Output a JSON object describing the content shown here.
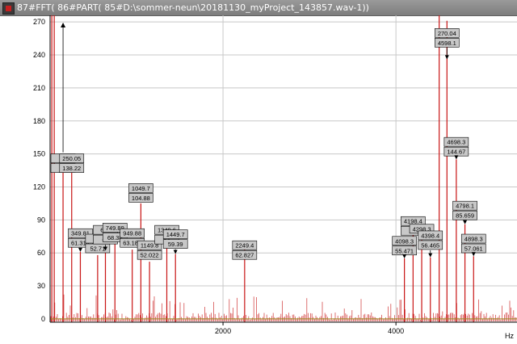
{
  "window": {
    "title": "87#FFT( 86#PART( 85#D:\\sommer-neun\\20181130_myProject_143857.wav-1))",
    "icon": "fft-window-icon"
  },
  "colors": {
    "signal": "#c81414",
    "grid": "#c8c8c8",
    "axis": "#000000",
    "baseline": "#9a8a20",
    "label_bg": "#c8c8c8"
  },
  "chart_data": {
    "type": "bar",
    "xlabel": "Hz",
    "ylabel": "",
    "xlim": [
      0,
      5400
    ],
    "ylim": [
      -3,
      276
    ],
    "x_ticks": [
      2000,
      4000
    ],
    "y_ticks": [
      0,
      30,
      60,
      90,
      120,
      150,
      180,
      210,
      240,
      270
    ],
    "grid": true,
    "peaks": [
      {
        "x": 20,
        "y": 276
      },
      {
        "x": 48,
        "y": 276
      },
      {
        "x": 150,
        "y": 139
      },
      {
        "x": 250,
        "y": 138
      },
      {
        "x": 350,
        "y": 61
      },
      {
        "x": 550,
        "y": 58
      },
      {
        "x": 640,
        "y": 62
      },
      {
        "x": 750,
        "y": 68
      },
      {
        "x": 950,
        "y": 63
      },
      {
        "x": 1050,
        "y": 105
      },
      {
        "x": 1150,
        "y": 52
      },
      {
        "x": 1350,
        "y": 65
      },
      {
        "x": 1450,
        "y": 59
      },
      {
        "x": 2250,
        "y": 63
      },
      {
        "x": 4098,
        "y": 55
      },
      {
        "x": 4198,
        "y": 77
      },
      {
        "x": 4298,
        "y": 72
      },
      {
        "x": 4398,
        "y": 56
      },
      {
        "x": 4500,
        "y": 276
      },
      {
        "x": 4590,
        "y": 271
      },
      {
        "x": 4698,
        "y": 145
      },
      {
        "x": 4798,
        "y": 86
      },
      {
        "x": 4898,
        "y": 57
      }
    ],
    "annotations": [
      {
        "x": 150,
        "y": 139,
        "freq": "14",
        "mag": "13",
        "lx": 150,
        "ly": 150
      },
      {
        "x": 250,
        "y": 138,
        "freq": "250.05",
        "mag": "138.22",
        "lx": 250,
        "ly": 150
      },
      {
        "x": 350,
        "y": 61,
        "freq": "349.81",
        "mag": "61.314",
        "lx": 350,
        "ly": 82
      },
      {
        "x": 550,
        "y": 58,
        "freq": "54",
        "mag": "52.71",
        "lx": 550,
        "ly": 77
      },
      {
        "x": 640,
        "y": 62,
        "freq": "649",
        "mag": "63",
        "lx": 640,
        "ly": 85
      },
      {
        "x": 750,
        "y": 68,
        "freq": "749.89",
        "mag": "68.38",
        "lx": 750,
        "ly": 87
      },
      {
        "x": 950,
        "y": 63,
        "freq": "949.88",
        "mag": "63.182",
        "lx": 950,
        "ly": 82
      },
      {
        "x": 1050,
        "y": 105,
        "freq": "1049.7",
        "mag": "104.88",
        "lx": 1050,
        "ly": 123
      },
      {
        "x": 1150,
        "y": 52,
        "freq": "1149.8",
        "mag": "52.022",
        "lx": 1150,
        "ly": 71
      },
      {
        "x": 1350,
        "y": 65,
        "freq": "1349.6",
        "mag": "64",
        "lx": 1350,
        "ly": 85
      },
      {
        "x": 1450,
        "y": 59,
        "freq": "1449.7",
        "mag": "59.39",
        "lx": 1450,
        "ly": 81
      },
      {
        "x": 2250,
        "y": 63,
        "freq": "2249.4",
        "mag": "62.827",
        "lx": 2250,
        "ly": 71
      },
      {
        "x": 4098,
        "y": 55,
        "freq": "4098.3",
        "mag": "55.471",
        "lx": 4098,
        "ly": 75
      },
      {
        "x": 4198,
        "y": 77,
        "freq": "4198.4",
        "mag": "71",
        "lx": 4198,
        "ly": 93
      },
      {
        "x": 4298,
        "y": 72,
        "freq": "4298.3",
        "mag": "",
        "lx": 4298,
        "ly": 86
      },
      {
        "x": 4398,
        "y": 56,
        "freq": "4398.4",
        "mag": "56.465",
        "lx": 4398,
        "ly": 80
      },
      {
        "x": 4590,
        "y": 271,
        "freq": "270.04",
        "mag": "4598.1",
        "lx": 4590,
        "ly": 264
      },
      {
        "x": 4698,
        "y": 145,
        "freq": "4698.3",
        "mag": "144.67",
        "lx": 4698,
        "ly": 165
      },
      {
        "x": 4798,
        "y": 86,
        "freq": "4798.1",
        "mag": "85.659",
        "lx": 4798,
        "ly": 107
      },
      {
        "x": 4898,
        "y": 57,
        "freq": "4898.3",
        "mag": "57.061",
        "lx": 4898,
        "ly": 77
      }
    ]
  }
}
